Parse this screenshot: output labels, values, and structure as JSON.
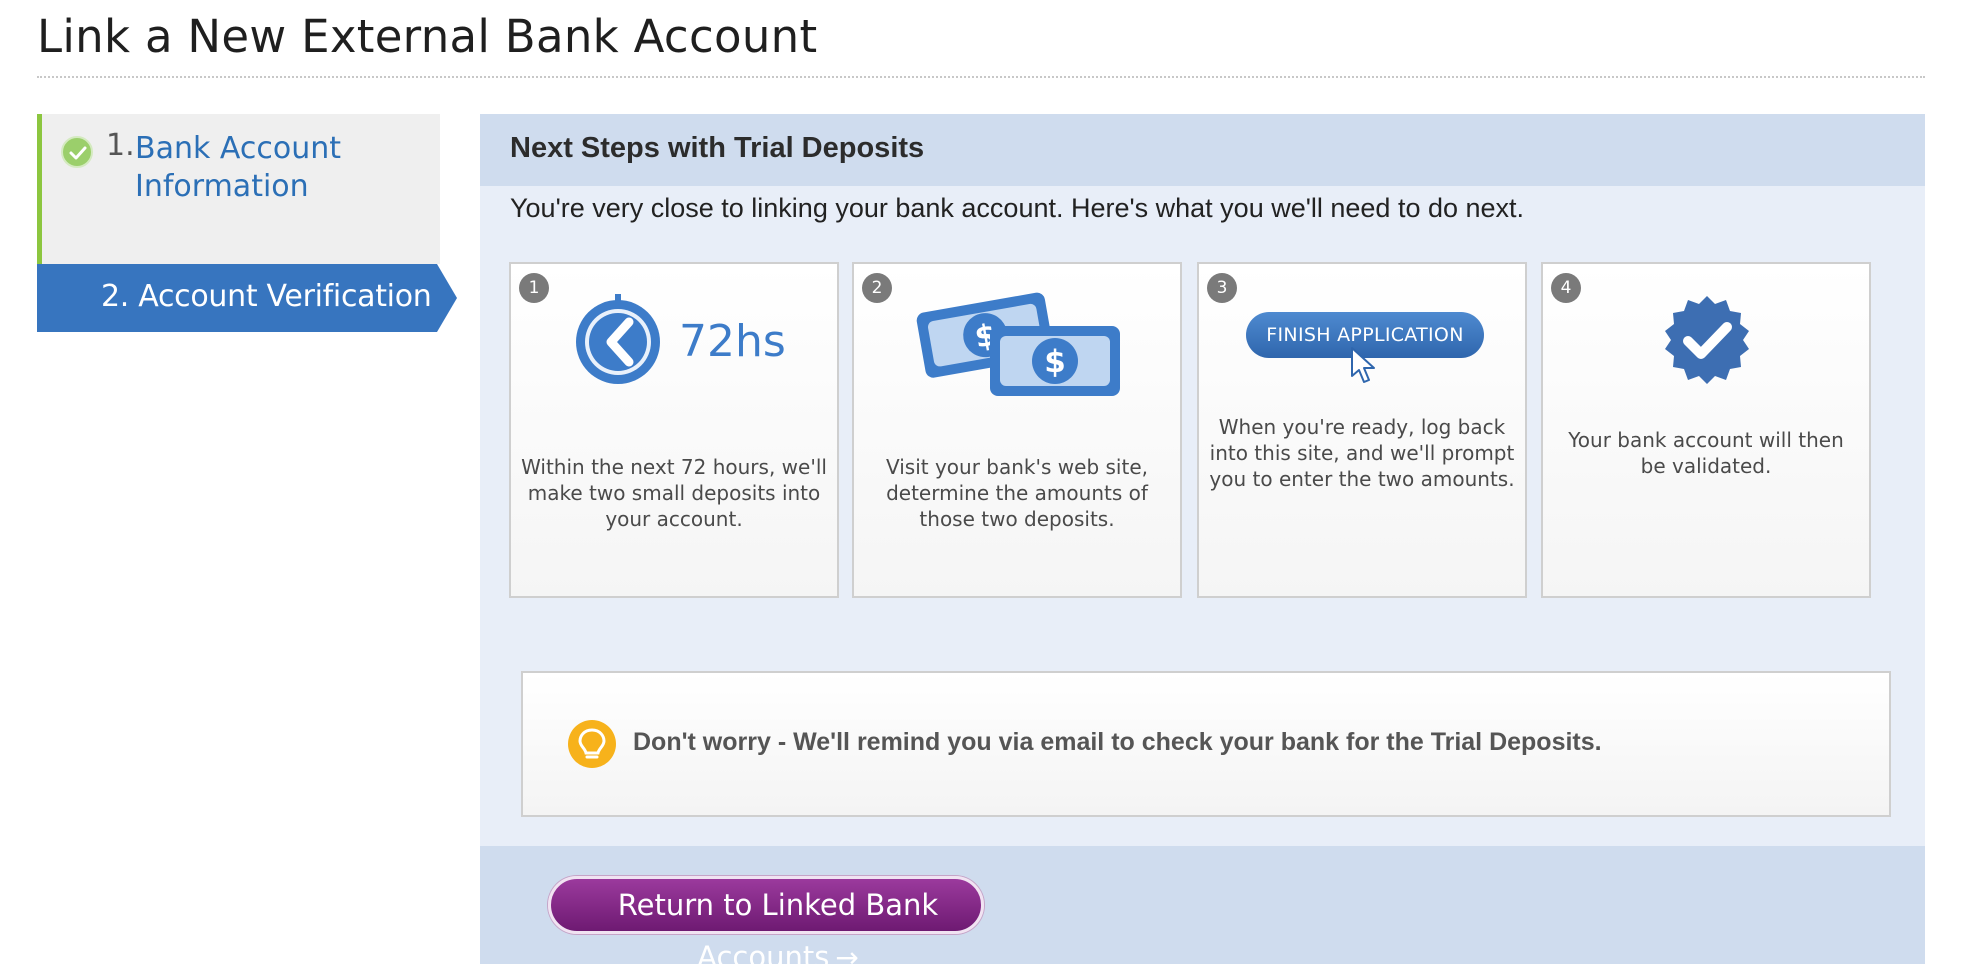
{
  "page": {
    "title": "Link a New External Bank Account"
  },
  "sidebar": {
    "steps": [
      {
        "number": "1.",
        "label": "Bank Account Information",
        "status": "complete",
        "icon": "check-icon"
      },
      {
        "label": "2. Account Verification",
        "status": "current"
      }
    ]
  },
  "panel": {
    "title": "Next Steps with Trial Deposits",
    "intro": "You're very close to linking your bank account. Here's what you we'll need to do next.",
    "cards": [
      {
        "number": "1",
        "icon": "clock-icon",
        "icon_label": "72hs",
        "text": "Within the next 72 hours, we'll make two small deposits into your account."
      },
      {
        "number": "2",
        "icon": "money-icon",
        "text": "Visit your bank's web site, determine the amounts of those two deposits."
      },
      {
        "number": "3",
        "icon": "cursor-icon",
        "button_label": "FINISH APPLICATION",
        "text": "When you're ready, log back into this site, and we'll prompt you to enter the two amounts."
      },
      {
        "number": "4",
        "icon": "verified-badge-icon",
        "text": "Your bank account will then be validated."
      }
    ],
    "tip": {
      "icon": "lightbulb-icon",
      "text": "Don't worry - We'll remind you via email to check your bank for the Trial Deposits."
    },
    "footer": {
      "return_button": "Return to Linked Bank Accounts",
      "arrow": "→"
    }
  },
  "colors": {
    "accent_blue": "#3775bf",
    "complete_green": "#8cc63f",
    "button_purple": "#7d2580",
    "panel_bg": "#e8eef8",
    "panel_header_bg": "#cfdcee",
    "tip_yellow": "#f7b21b"
  }
}
